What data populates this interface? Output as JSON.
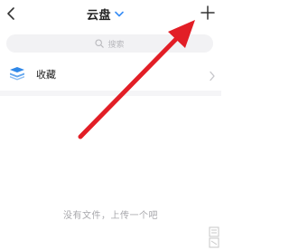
{
  "header": {
    "title": "云盘",
    "back_icon": "chevron-left-icon",
    "add_icon": "plus-icon",
    "title_chevron_icon": "chevron-down-icon",
    "accent": "#3a8ef6"
  },
  "search": {
    "placeholder": "搜索",
    "icon": "search-icon"
  },
  "favorites": {
    "label": "收藏",
    "icon": "stack-icon",
    "icon_color": "#2f88e8"
  },
  "empty_state": {
    "text": "没有文件，上传一个吧"
  },
  "annotation": {
    "color": "#e21e26"
  }
}
